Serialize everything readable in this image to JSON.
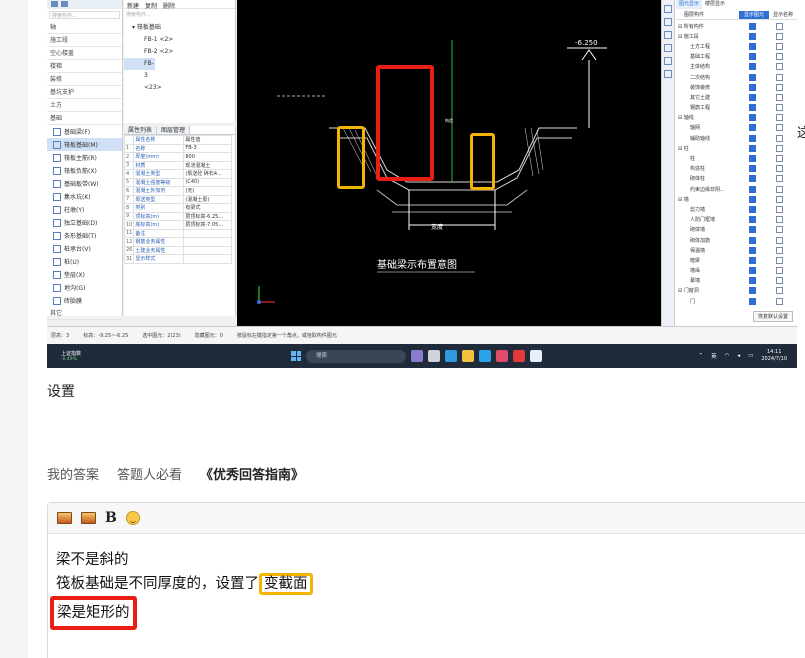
{
  "screenshot": {
    "nav": {
      "categories": [
        "轴",
        "施工段",
        "空心楼盖",
        "楼梯",
        "装修",
        "基坑支护",
        "土方",
        "基础"
      ],
      "foundation_items": [
        {
          "label": "基础梁(F)",
          "selected": false
        },
        {
          "label": "筏板基础(M)",
          "selected": true
        },
        {
          "label": "筏板主筋(R)",
          "selected": false
        },
        {
          "label": "筏板负筋(X)",
          "selected": false
        },
        {
          "label": "基础板带(W)",
          "selected": false
        },
        {
          "label": "集水坑(K)",
          "selected": false
        },
        {
          "label": "柱墩(Y)",
          "selected": false
        },
        {
          "label": "独立基础(D)",
          "selected": false
        },
        {
          "label": "条形基础(T)",
          "selected": false
        },
        {
          "label": "桩承台(V)",
          "selected": false
        },
        {
          "label": "桩(U)",
          "selected": false
        },
        {
          "label": "垫层(X)",
          "selected": false
        },
        {
          "label": "地沟(G)",
          "selected": false
        },
        {
          "label": "砖胎膜",
          "selected": false
        }
      ],
      "other_label": "其它",
      "search_placeholder": "搜索构件..."
    },
    "tree": {
      "toolbar": [
        "新建",
        "复制",
        "删除"
      ],
      "search_placeholder": "搜索构件...",
      "group": "筏板基础",
      "items": [
        {
          "label": "FB-1 <2>",
          "selected": false
        },
        {
          "label": "FB-2 <2>",
          "selected": false
        },
        {
          "label": "FB-3 <23>",
          "selected": true
        }
      ]
    },
    "props": {
      "tabs": [
        "属性列表",
        "图层管理"
      ],
      "header": [
        "属性名称",
        "属性值"
      ],
      "rows": [
        [
          "1",
          "名称",
          "FB-3"
        ],
        [
          "2",
          "厚度(mm)",
          "800"
        ],
        [
          "3",
          "材质",
          "现浇混凝土"
        ],
        [
          "4",
          "混凝土类型",
          "(泵送砼 碎石4..."
        ],
        [
          "5",
          "混凝土强度等级",
          "(C40)"
        ],
        [
          "6",
          "混凝土外加剂",
          "(无)"
        ],
        [
          "7",
          "泵送类型",
          "(混凝土泵)"
        ],
        [
          "8",
          "类别",
          "有梁式"
        ],
        [
          "9",
          "顶标高(m)",
          "层顶标高-6.25..."
        ],
        [
          "10",
          "底标高(m)",
          "层顶标高-7.05..."
        ],
        [
          "11",
          "备注",
          ""
        ],
        [
          "12",
          "钢筋业务属性",
          ""
        ],
        [
          "26",
          "土建业务属性",
          ""
        ],
        [
          "31",
          "显示样式",
          ""
        ]
      ]
    },
    "cad": {
      "elevation": "-6.250",
      "section_title": "基础梁示布置意图",
      "width_label": "宽度",
      "beam_label": "构造"
    },
    "layers": {
      "tabs": [
        "图元显示",
        "楼层显示"
      ],
      "columns": [
        "图层构件",
        "显示图元",
        "显示名称"
      ],
      "rows": [
        {
          "label": "所有构件",
          "level": "group",
          "show": true,
          "name": false
        },
        {
          "label": "施工段",
          "level": "group",
          "show": true,
          "name": false
        },
        {
          "label": "土方工程",
          "level": "leaf",
          "show": true,
          "name": false
        },
        {
          "label": "基础工程",
          "level": "leaf",
          "show": true,
          "name": false
        },
        {
          "label": "主体结构",
          "level": "leaf",
          "show": true,
          "name": false
        },
        {
          "label": "二次结构",
          "level": "leaf",
          "show": true,
          "name": false
        },
        {
          "label": "装饰装修",
          "level": "leaf",
          "show": true,
          "name": false
        },
        {
          "label": "其它土建",
          "level": "leaf",
          "show": true,
          "name": false
        },
        {
          "label": "钢筋工程",
          "level": "leaf",
          "show": true,
          "name": false
        },
        {
          "label": "轴线",
          "level": "group",
          "show": true,
          "name": false
        },
        {
          "label": "轴网",
          "level": "leaf",
          "show": true,
          "name": false
        },
        {
          "label": "辅助轴线",
          "level": "leaf",
          "show": true,
          "name": false
        },
        {
          "label": "柱",
          "level": "group",
          "show": true,
          "name": false
        },
        {
          "label": "柱",
          "level": "leaf",
          "show": true,
          "name": false
        },
        {
          "label": "构造柱",
          "level": "leaf",
          "show": true,
          "name": false
        },
        {
          "label": "砌体柱",
          "level": "leaf",
          "show": true,
          "name": false
        },
        {
          "label": "约束边缘非阴...",
          "level": "leaf",
          "show": true,
          "name": false
        },
        {
          "label": "墙",
          "level": "group",
          "show": true,
          "name": false
        },
        {
          "label": "剪力墙",
          "level": "leaf",
          "show": true,
          "name": false
        },
        {
          "label": "人防门框墙",
          "level": "leaf",
          "show": true,
          "name": false
        },
        {
          "label": "砌体墙",
          "level": "leaf",
          "show": true,
          "name": false
        },
        {
          "label": "砌体加筋",
          "level": "leaf",
          "show": true,
          "name": false
        },
        {
          "label": "保温墙",
          "level": "leaf",
          "show": true,
          "name": false
        },
        {
          "label": "暗梁",
          "level": "leaf",
          "show": true,
          "name": false
        },
        {
          "label": "墙垛",
          "level": "leaf",
          "show": true,
          "name": false
        },
        {
          "label": "幕墙",
          "level": "leaf",
          "show": true,
          "name": false
        },
        {
          "label": "门窗洞",
          "level": "group",
          "show": true,
          "name": false
        },
        {
          "label": "门",
          "level": "leaf",
          "show": true,
          "name": false
        }
      ],
      "reset_button": "恢复默认设置"
    },
    "status": {
      "floor": "层高：3",
      "elevation": "标高：-9.25~-6.25",
      "selected": "选中图元：2(23)",
      "hidden": "隐藏图元：0",
      "hint": "按鼠标左键指定第一个角点，或拾取构件图元"
    },
    "taskbar": {
      "weather_title": "上证指数",
      "weather_change": "-0.49%",
      "search_placeholder": "搜索",
      "ime": "英",
      "time": "14:11",
      "date": "2024/7/10"
    }
  },
  "edge_char": "这",
  "page": {
    "setting_label": "设置",
    "answer_tabs": [
      "我的答案",
      "答题人必看",
      "《优秀回答指南》"
    ],
    "editor": {
      "toolbar": [
        "image-icon",
        "image-upload-icon",
        "bold-icon",
        "emoji-icon"
      ],
      "bold_glyph": "B",
      "lines": [
        {
          "text": "梁不是斜的"
        },
        {
          "pre": "筏板基础是不同厚度的，设置了",
          "highlight": "变截面"
        },
        {
          "highlight": "梁是矩形的"
        }
      ]
    }
  },
  "colors": {
    "highlight_red": "#e81f12",
    "highlight_orange": "#f2b400",
    "cad_background": "#000000"
  }
}
